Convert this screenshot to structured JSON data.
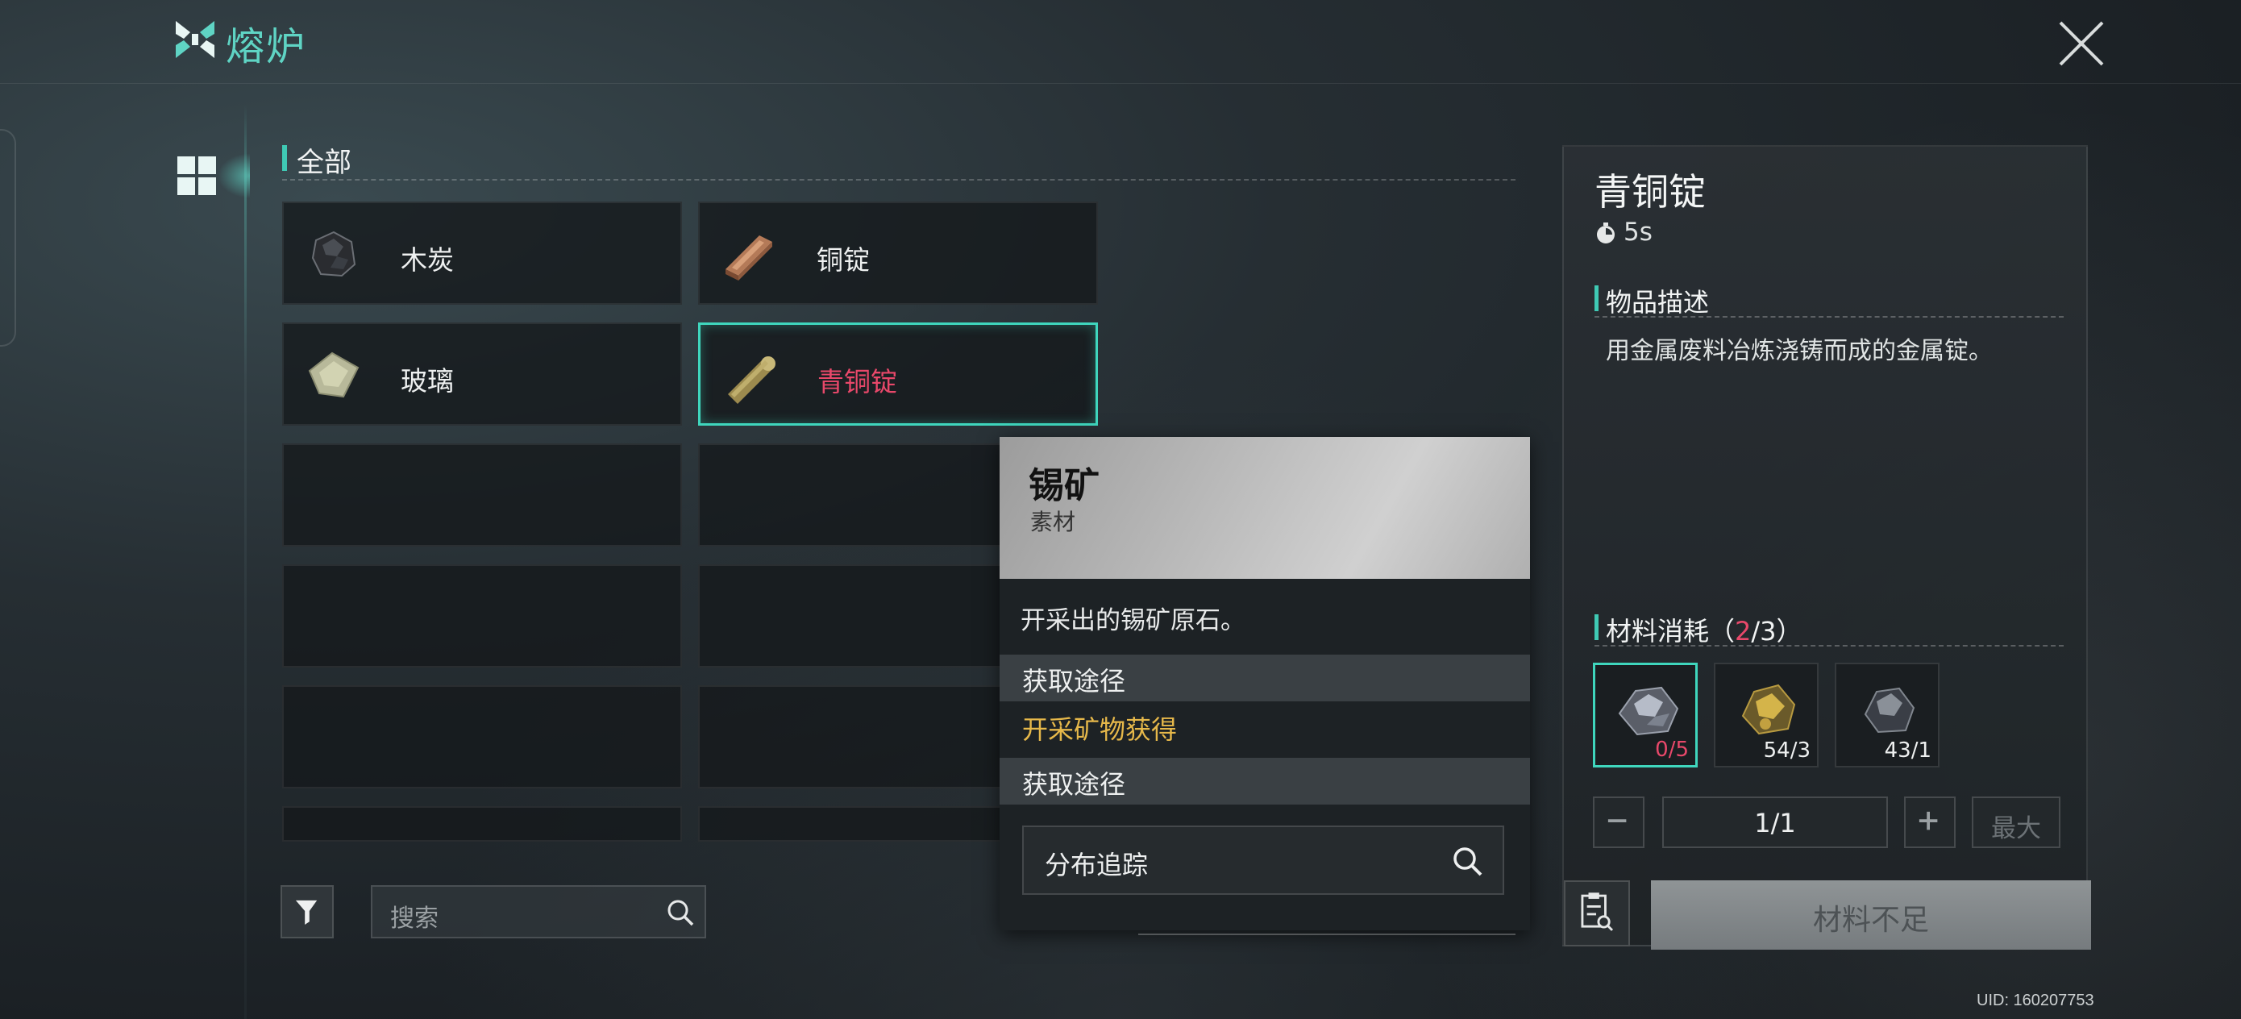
{
  "app": {
    "title": "熔炉",
    "logo_icon": "furnace-logo-icon",
    "close_icon": "close-icon",
    "accent": "#5fd4c4"
  },
  "category": {
    "label": "全部",
    "tab_icon": "grid-icon"
  },
  "items": [
    {
      "name": "木炭",
      "icon": "charcoal-icon"
    },
    {
      "name": "铜锭",
      "icon": "copper-ingot-icon"
    },
    {
      "name": "玻璃",
      "icon": "glass-icon"
    },
    {
      "name": "青铜锭",
      "icon": "bronze-ingot-icon",
      "selected": true
    }
  ],
  "search": {
    "placeholder": "搜索",
    "filter_icon": "filter-icon",
    "search_icon": "search-icon"
  },
  "popup": {
    "title": "锡矿",
    "type": "素材",
    "description": "开采出的锡矿原石。",
    "section_source": "获取途径",
    "source": "开采矿物获得",
    "section_track": "获取途径",
    "track_label": "分布追踪"
  },
  "detail": {
    "title": "青铜锭",
    "time": "5s",
    "desc_header": "物品描述",
    "description": "用金属废料冶炼浇铸而成的金属锭。",
    "materials_header": "材料消耗（",
    "materials_have": "2",
    "materials_sep": "/",
    "materials_total": "3",
    "materials_close": "）",
    "materials": [
      {
        "icon": "tin-ore-icon",
        "count": "0/5",
        "insufficient": true
      },
      {
        "icon": "gold-ore-icon",
        "count": "54/3"
      },
      {
        "icon": "ore-icon",
        "count": "43/1"
      }
    ],
    "quantity": "1/1",
    "max_label": "最大",
    "craft_label": "材料不足",
    "status_color": "#e8486a"
  },
  "uid": "UID: 160207753"
}
